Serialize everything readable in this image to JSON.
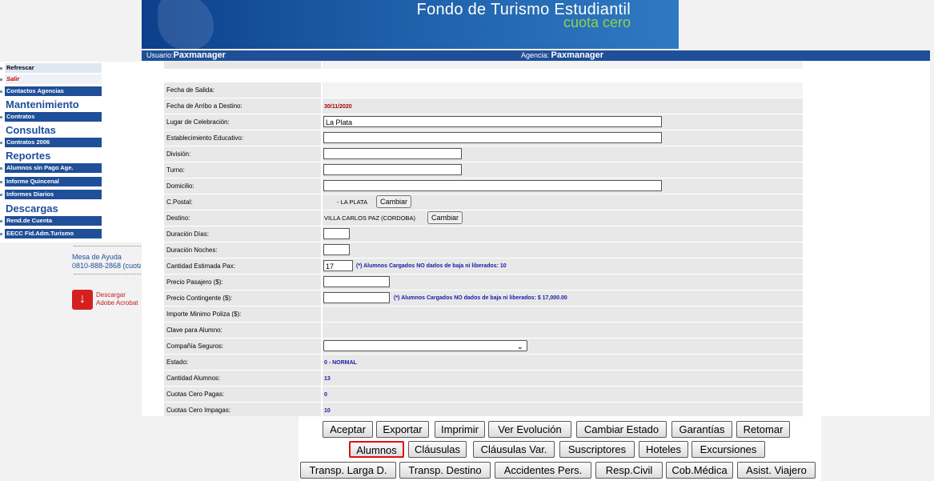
{
  "banner": {
    "title": "Fondo de Turismo Estudiantil",
    "subtitle": "cuota cero"
  },
  "userbar": {
    "usuario_label": "Usuario:",
    "usuario": "Paxmanager",
    "agencia_label": "Agencia:",
    "agencia": "Paxmanager"
  },
  "sidebar": {
    "refrescar": "Refrescar",
    "salir": "Salir",
    "contactos": "Contactos Agencias",
    "h_mant": "Mantenimiento",
    "contratos": "Contratos",
    "h_cons": "Consultas",
    "contratos2006": "Contratos 2006",
    "h_rep": "Reportes",
    "alumnos_sin_pago": "Alumnos sin Pago Age.",
    "informe_quincenal": "Informe Quincenal",
    "informes_diarios": "Informes Diarios",
    "h_desc": "Descargas",
    "rend_cuenta": "Rend.de Cuenta",
    "eecc": "EECC Fid.Adm.Turismo"
  },
  "help": {
    "line1": "Mesa de Ayuda",
    "line2": "0810-888-2868 (cuota"
  },
  "acrobat": {
    "line1": "Descargar",
    "line2": "Adobe Acrobat"
  },
  "form": {
    "fecha_salida": "Fecha de Salida:",
    "fecha_arribo": "Fecha de Arribo a Destino:",
    "fecha_arribo_val": "30/11/2020",
    "lugar": "Lugar de Celebración:",
    "lugar_val": "La Plata",
    "establecimiento": "Establecimiento Educativo:",
    "division": "División:",
    "turno": "Turno:",
    "domicilio": "Domicilio:",
    "cpostal": "C.Postal:",
    "cpostal_val": "- LA PLATA",
    "cambiar": "Cambiar",
    "destino": "Destino:",
    "destino_val": "VILLA CARLOS PAZ (CORDOBA)",
    "dur_dias": "Duración Días:",
    "dur_noches": "Duración Noches:",
    "cant_pax": "Cantidad Estimada Pax:",
    "cant_pax_val": "17",
    "cant_pax_note": "(*) Alumnos Cargados NO dados de baja ni liberados: 10",
    "precio_pasajero": "Precio Pasajero ($):",
    "precio_contingente": "Precio Contingente ($):",
    "precio_cont_note": "(*) Alumnos Cargados NO dados de baja ni liberados: $ 17,000.00",
    "importe_minimo": "Importe Minimo Poliza ($):",
    "clave": "Clave para Alumno:",
    "compania": "Compañía Seguros:",
    "estado": "Estado:",
    "estado_val": "0 - NORMAL",
    "cant_alumnos": "Cantidad Alumnos:",
    "cant_alumnos_val": "13",
    "cuotas_pagas": "Cuotas Cero Pagas:",
    "cuotas_pagas_val": "0",
    "cuotas_impagas": "Cuotas Cero Impagas:",
    "cuotas_impagas_val": "10"
  },
  "buttons": {
    "aceptar": "Aceptar",
    "exportar": "Exportar",
    "imprimir": "Imprimir",
    "ver_evolucion": "Ver Evolución",
    "cambiar_estado": "Cambiar Estado",
    "garantias": "Garantías",
    "retomar": "Retomar",
    "alumnos": "Alumnos",
    "clausulas": "Cláusulas",
    "clausulas_var": "Cláusulas Var.",
    "suscriptores": "Suscriptores",
    "hoteles": "Hoteles",
    "excursiones": "Excursiones",
    "transp_larga": "Transp. Larga D.",
    "transp_destino": "Transp. Destino",
    "accidentes": "Accidentes Pers.",
    "resp_civil": "Resp.Civil",
    "cob_medica": "Cob.Médica",
    "asist_viajero": "Asist. Viajero"
  },
  "colors": {
    "nav_blue": "#1f4f98",
    "label_bg": "#e8e8e8",
    "highlight": "#e01010"
  }
}
